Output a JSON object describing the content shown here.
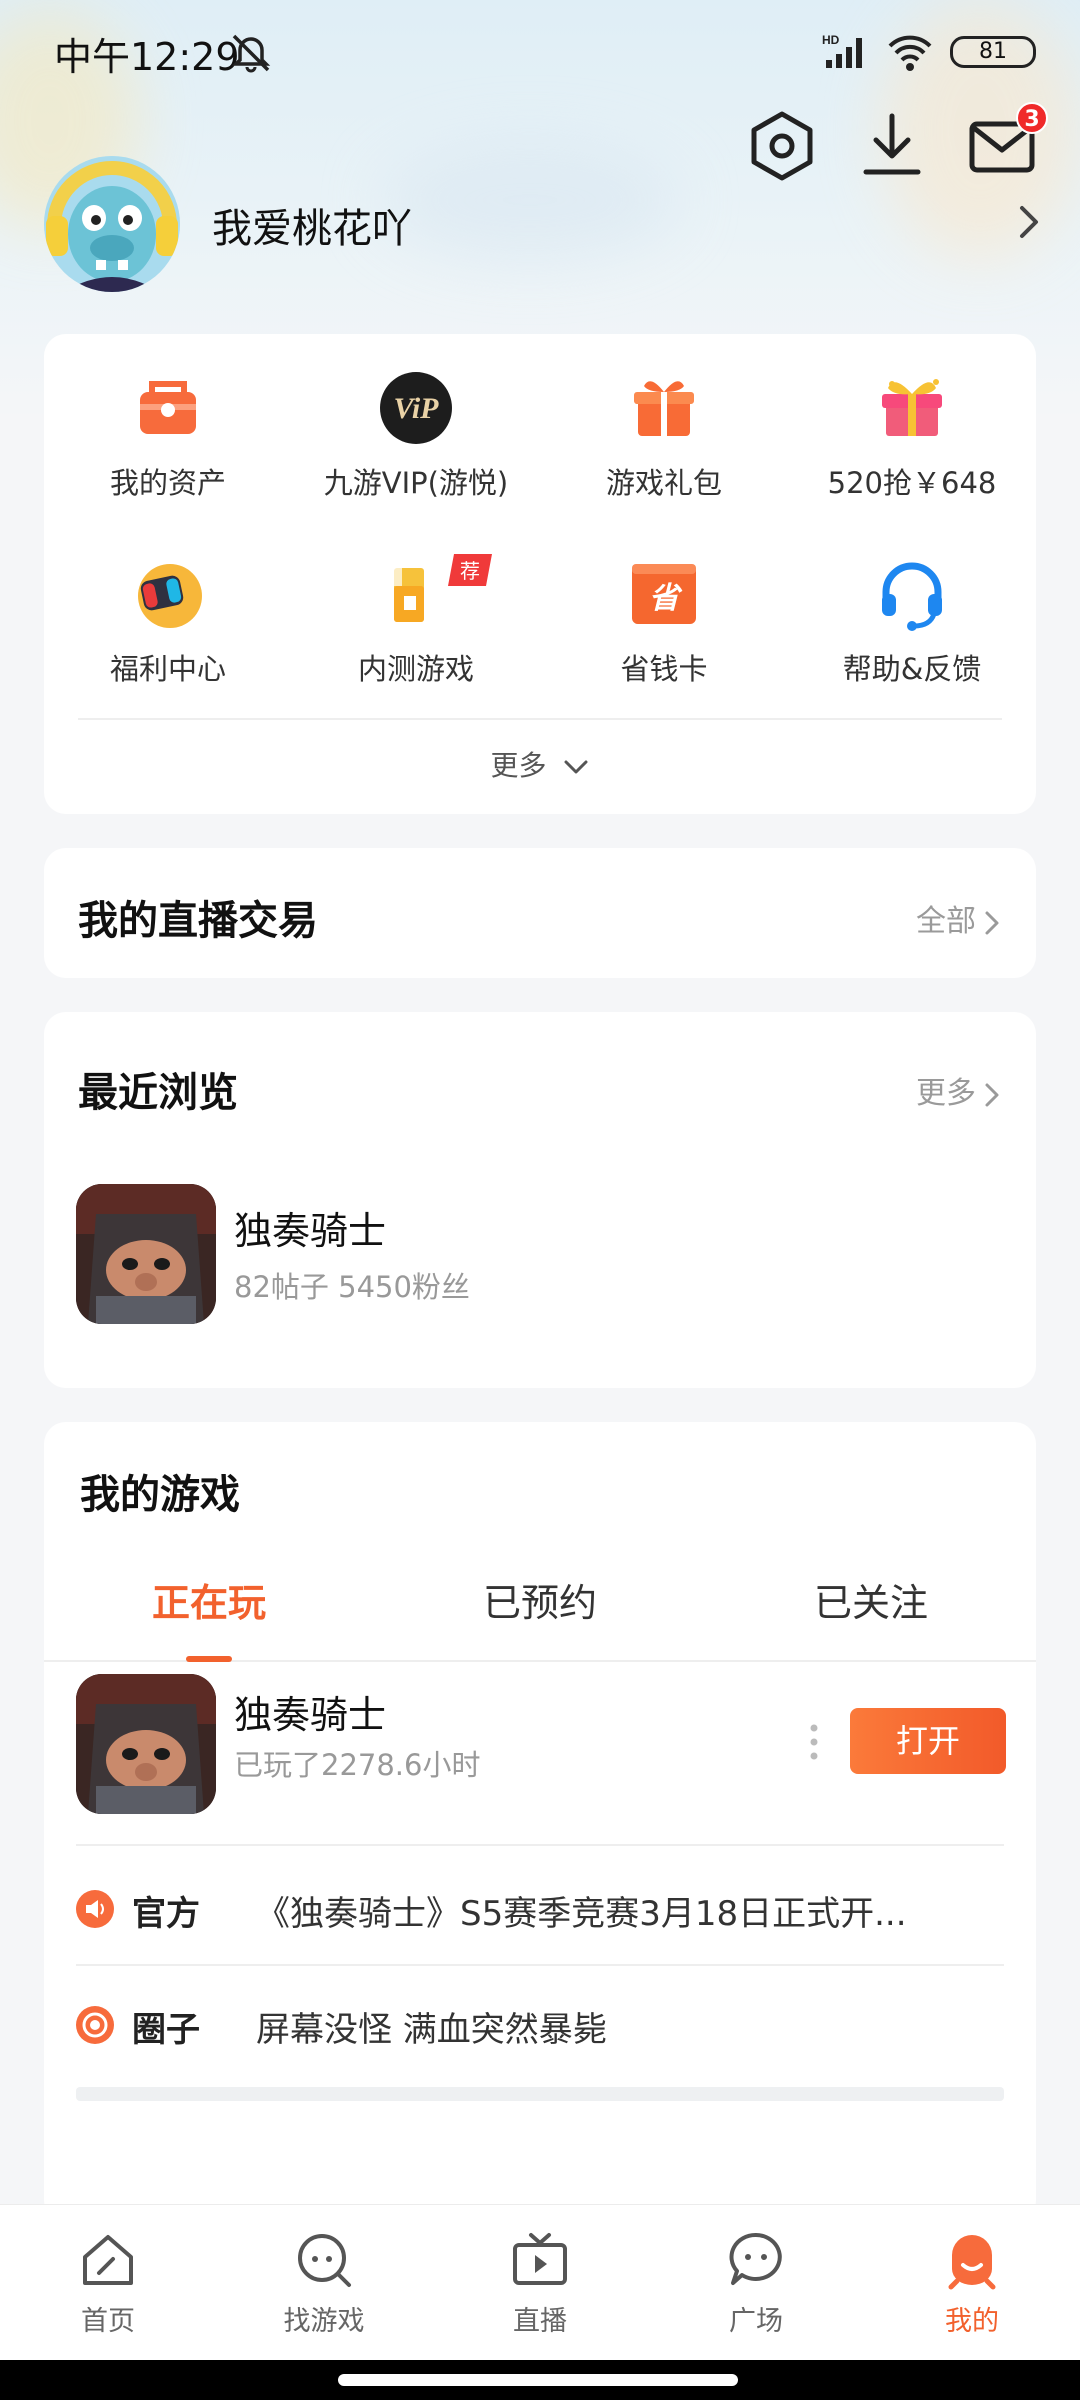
{
  "status_bar": {
    "time": "中午12:29",
    "signal_tag": "HD",
    "battery": "81",
    "icons": [
      "mute-icon",
      "signal-icon",
      "wifi-icon",
      "battery-icon"
    ]
  },
  "header": {
    "username": "我爱桃花吖",
    "mail_badge": "3",
    "icons": [
      "settings-hex-icon",
      "download-icon",
      "mail-icon",
      "chevron-right-icon"
    ]
  },
  "quick_grid": {
    "items": [
      {
        "label": "我的资产",
        "icon": "wallet-icon"
      },
      {
        "label": "九游VIP(游悦)",
        "icon": "vip-icon"
      },
      {
        "label": "游戏礼包",
        "icon": "gift-box-icon"
      },
      {
        "label": "520抢￥648",
        "icon": "present-icon"
      },
      {
        "label": "福利中心",
        "icon": "welfare-icon"
      },
      {
        "label": "内测游戏",
        "icon": "beta-game-icon",
        "badge": "荐"
      },
      {
        "label": "省钱卡",
        "icon": "saving-card-icon",
        "card_text": "省"
      },
      {
        "label": "帮助&反馈",
        "icon": "headset-icon"
      }
    ],
    "more_label": "更多"
  },
  "live_trade": {
    "title": "我的直播交易",
    "link": "全部"
  },
  "recent": {
    "title": "最近浏览",
    "link": "更多",
    "game": {
      "name": "独奏骑士",
      "stats": "82帖子  5450粉丝"
    }
  },
  "my_games": {
    "title": "我的游戏",
    "tabs": [
      "正在玩",
      "已预约",
      "已关注"
    ],
    "active_tab": 0,
    "game": {
      "name": "独奏骑士",
      "playtime": "已玩了2278.6小时",
      "open_label": "打开"
    },
    "feeds": [
      {
        "tag": "官方",
        "text": "《独奏骑士》S5赛季竞赛3月18日正式开...",
        "icon": "speaker-icon"
      },
      {
        "tag": "圈子",
        "text": "屏幕没怪 满血突然暴毙",
        "icon": "circle-icon"
      }
    ]
  },
  "bottom_nav": {
    "items": [
      {
        "label": "首页",
        "icon": "home-icon"
      },
      {
        "label": "找游戏",
        "icon": "find-game-icon"
      },
      {
        "label": "直播",
        "icon": "live-tv-icon"
      },
      {
        "label": "广场",
        "icon": "square-chat-icon"
      },
      {
        "label": "我的",
        "icon": "profile-icon"
      }
    ],
    "active": 4
  },
  "colors": {
    "accent": "#f2612d",
    "badge": "#f02a2a"
  }
}
